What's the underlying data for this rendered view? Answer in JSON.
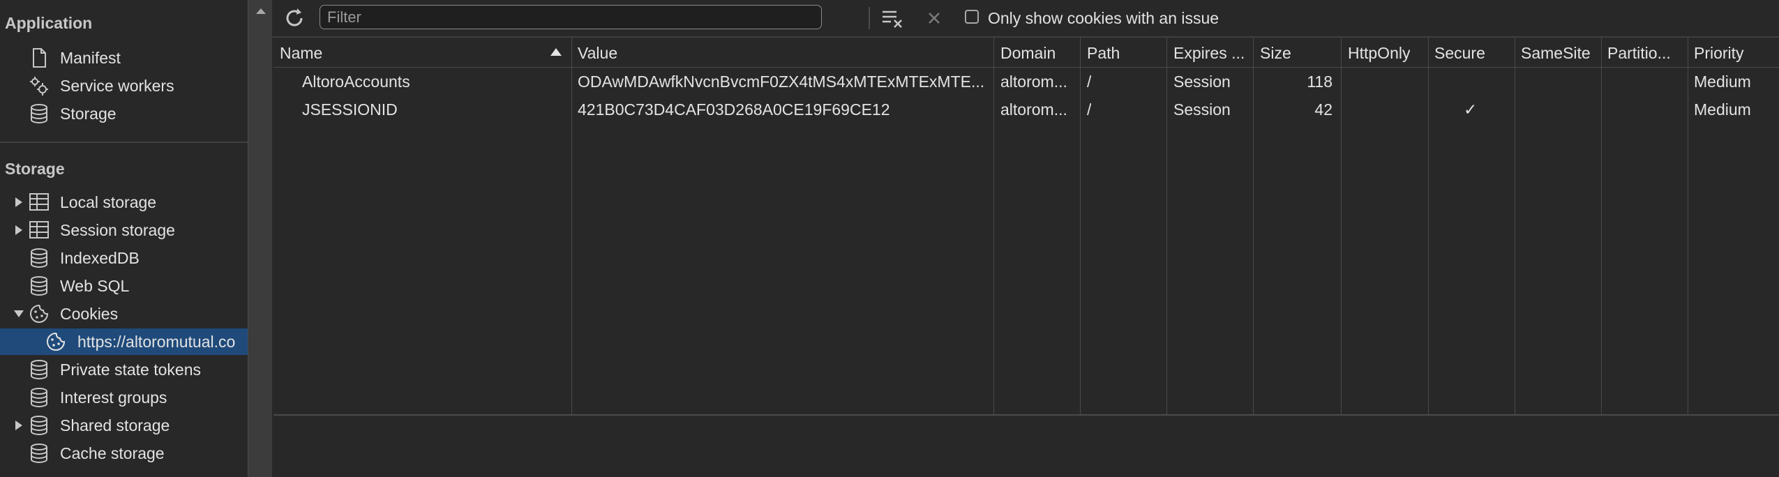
{
  "sidebar": {
    "application_title": "Application",
    "application_items": [
      {
        "label": "Manifest",
        "icon": "document-icon"
      },
      {
        "label": "Service workers",
        "icon": "gears-icon"
      },
      {
        "label": "Storage",
        "icon": "database-icon"
      }
    ],
    "storage_title": "Storage",
    "storage_items": [
      {
        "label": "Local storage",
        "icon": "table-icon",
        "expandable": true
      },
      {
        "label": "Session storage",
        "icon": "table-icon",
        "expandable": true
      },
      {
        "label": "IndexedDB",
        "icon": "database-icon"
      },
      {
        "label": "Web SQL",
        "icon": "database-icon"
      },
      {
        "label": "Cookies",
        "icon": "cookie-icon",
        "expanded": true
      },
      {
        "label": "https://altoromutual.co",
        "icon": "cookie-icon",
        "selected": true
      },
      {
        "label": "Private state tokens",
        "icon": "database-icon"
      },
      {
        "label": "Interest groups",
        "icon": "database-icon"
      },
      {
        "label": "Shared storage",
        "icon": "database-icon",
        "expandable": true
      },
      {
        "label": "Cache storage",
        "icon": "database-icon"
      }
    ]
  },
  "toolbar": {
    "filter_placeholder": "Filter",
    "only_issues_label": "Only show cookies with an issue",
    "only_issues_checked": false
  },
  "table": {
    "columns": [
      "Name",
      "Value",
      "Domain",
      "Path",
      "Expires ...",
      "Size",
      "HttpOnly",
      "Secure",
      "SameSite",
      "Partitio...",
      "Priority"
    ],
    "sorted_column": "Name",
    "sort_direction": "ascending",
    "rows": [
      {
        "name": "AltoroAccounts",
        "value": "ODAwMDAwfkNvcnBvcmF0ZX4tMS4xMTExMTExMTE...",
        "domain": "altorom...",
        "path": "/",
        "expires": "Session",
        "size": "118",
        "httponly": "",
        "secure": "",
        "samesite": "",
        "partition": "",
        "priority": "Medium"
      },
      {
        "name": "JSESSIONID",
        "value": "421B0C73D4CAF03D268A0CE19F69CE12",
        "domain": "altorom...",
        "path": "/",
        "expires": "Session",
        "size": "42",
        "httponly": "",
        "secure": "✓",
        "samesite": "",
        "partition": "",
        "priority": "Medium"
      }
    ]
  }
}
